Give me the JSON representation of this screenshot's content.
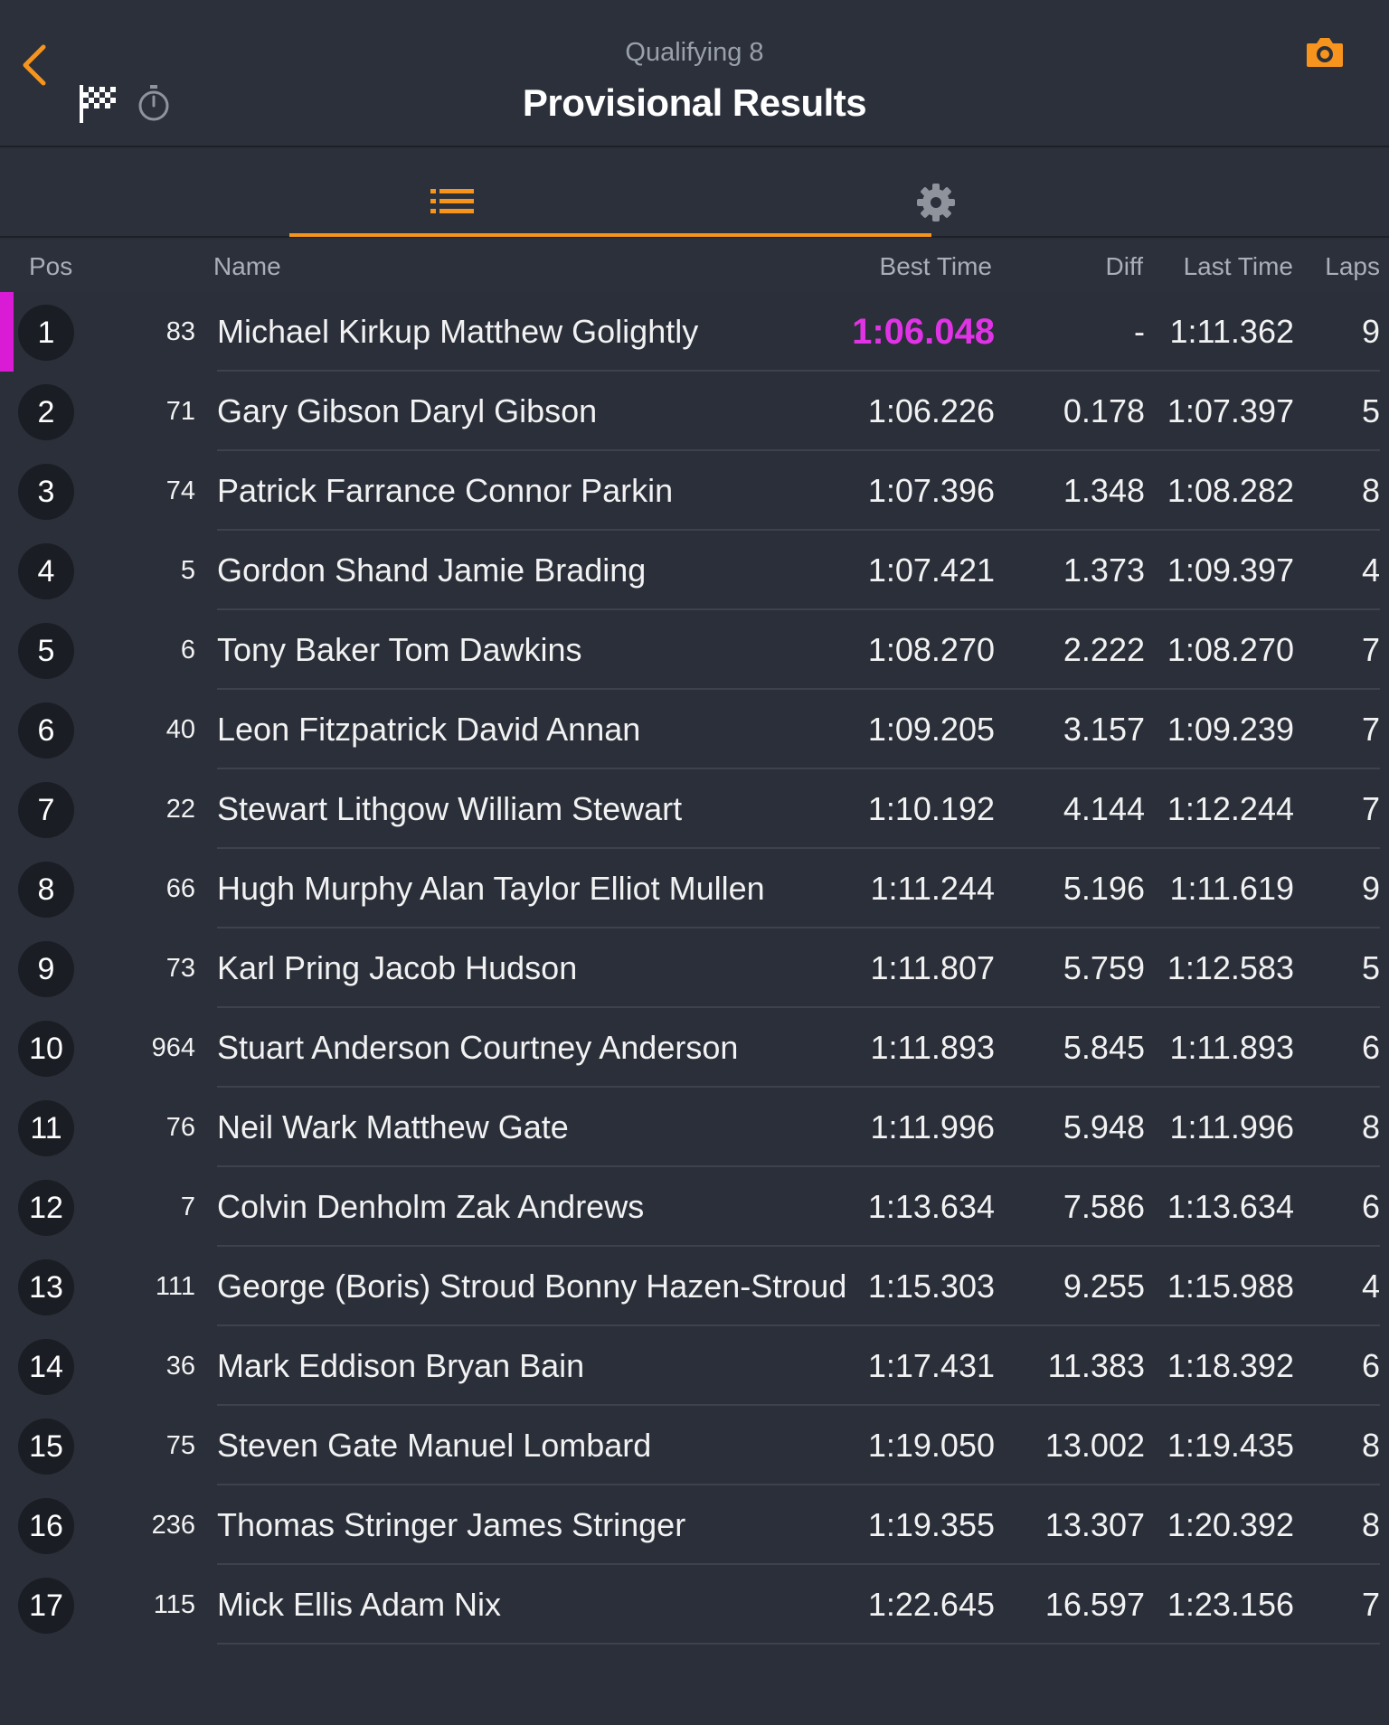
{
  "header": {
    "subtitle": "Qualifying 8",
    "title": "Provisional Results",
    "accent_color": "#f7941d"
  },
  "columns": {
    "pos": "Pos",
    "name": "Name",
    "best_time": "Best Time",
    "diff": "Diff",
    "last_time": "Last Time",
    "laps": "Laps"
  },
  "highlight_color": "#e133e6",
  "rows": [
    {
      "pos": "1",
      "num": "83",
      "name": "Michael Kirkup Matthew Golightly",
      "best": "1:06.048",
      "diff": "-",
      "last": "1:11.362",
      "laps": "9"
    },
    {
      "pos": "2",
      "num": "71",
      "name": "Gary Gibson Daryl Gibson",
      "best": "1:06.226",
      "diff": "0.178",
      "last": "1:07.397",
      "laps": "5"
    },
    {
      "pos": "3",
      "num": "74",
      "name": "Patrick Farrance Connor Parkin",
      "best": "1:07.396",
      "diff": "1.348",
      "last": "1:08.282",
      "laps": "8"
    },
    {
      "pos": "4",
      "num": "5",
      "name": "Gordon Shand Jamie Brading",
      "best": "1:07.421",
      "diff": "1.373",
      "last": "1:09.397",
      "laps": "4"
    },
    {
      "pos": "5",
      "num": "6",
      "name": "Tony Baker Tom Dawkins",
      "best": "1:08.270",
      "diff": "2.222",
      "last": "1:08.270",
      "laps": "7"
    },
    {
      "pos": "6",
      "num": "40",
      "name": "Leon Fitzpatrick David Annan",
      "best": "1:09.205",
      "diff": "3.157",
      "last": "1:09.239",
      "laps": "7"
    },
    {
      "pos": "7",
      "num": "22",
      "name": "Stewart Lithgow William Stewart",
      "best": "1:10.192",
      "diff": "4.144",
      "last": "1:12.244",
      "laps": "7"
    },
    {
      "pos": "8",
      "num": "66",
      "name": "Hugh Murphy Alan Taylor Elliot Mullen",
      "best": "1:11.244",
      "diff": "5.196",
      "last": "1:11.619",
      "laps": "9"
    },
    {
      "pos": "9",
      "num": "73",
      "name": "Karl Pring Jacob Hudson",
      "best": "1:11.807",
      "diff": "5.759",
      "last": "1:12.583",
      "laps": "5"
    },
    {
      "pos": "10",
      "num": "964",
      "name": "Stuart Anderson Courtney Anderson",
      "best": "1:11.893",
      "diff": "5.845",
      "last": "1:11.893",
      "laps": "6"
    },
    {
      "pos": "11",
      "num": "76",
      "name": "Neil Wark Matthew Gate",
      "best": "1:11.996",
      "diff": "5.948",
      "last": "1:11.996",
      "laps": "8"
    },
    {
      "pos": "12",
      "num": "7",
      "name": "Colvin Denholm Zak Andrews",
      "best": "1:13.634",
      "diff": "7.586",
      "last": "1:13.634",
      "laps": "6"
    },
    {
      "pos": "13",
      "num": "111",
      "name": "George (Boris) Stroud Bonny Hazen-Stroud",
      "best": "1:15.303",
      "diff": "9.255",
      "last": "1:15.988",
      "laps": "4"
    },
    {
      "pos": "14",
      "num": "36",
      "name": "Mark Eddison Bryan Bain",
      "best": "1:17.431",
      "diff": "11.383",
      "last": "1:18.392",
      "laps": "6"
    },
    {
      "pos": "15",
      "num": "75",
      "name": "Steven Gate Manuel Lombard",
      "best": "1:19.050",
      "diff": "13.002",
      "last": "1:19.435",
      "laps": "8"
    },
    {
      "pos": "16",
      "num": "236",
      "name": "Thomas Stringer James Stringer",
      "best": "1:19.355",
      "diff": "13.307",
      "last": "1:20.392",
      "laps": "8"
    },
    {
      "pos": "17",
      "num": "115",
      "name": "Mick Ellis Adam Nix",
      "best": "1:22.645",
      "diff": "16.597",
      "last": "1:23.156",
      "laps": "7"
    }
  ]
}
